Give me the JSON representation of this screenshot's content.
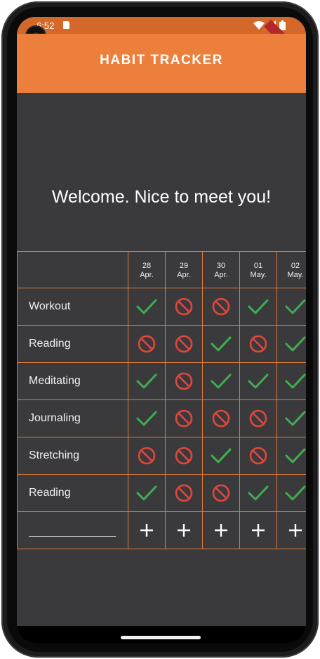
{
  "status_bar": {
    "time": "6:52"
  },
  "app_bar": {
    "title": "HABIT TRACKER",
    "debug_banner": "DEBUG"
  },
  "welcome": "Welcome. Nice to meet you!",
  "dates": [
    {
      "day": "28",
      "month": "Apr."
    },
    {
      "day": "29",
      "month": "Apr."
    },
    {
      "day": "30",
      "month": "Apr."
    },
    {
      "day": "01",
      "month": "May."
    },
    {
      "day": "02",
      "month": "May."
    }
  ],
  "habits": [
    {
      "name": "Workout",
      "marks": [
        "done",
        "missed",
        "missed",
        "done",
        "done"
      ]
    },
    {
      "name": "Reading",
      "marks": [
        "missed",
        "missed",
        "done",
        "missed",
        "done"
      ]
    },
    {
      "name": "Meditating",
      "marks": [
        "done",
        "missed",
        "done",
        "done",
        "done"
      ]
    },
    {
      "name": "Journaling",
      "marks": [
        "done",
        "missed",
        "missed",
        "missed",
        "done"
      ]
    },
    {
      "name": "Stretching",
      "marks": [
        "missed",
        "missed",
        "done",
        "missed",
        "done"
      ]
    },
    {
      "name": "Reading",
      "marks": [
        "done",
        "missed",
        "missed",
        "done",
        "done"
      ]
    }
  ],
  "add_row": {
    "symbol": "+"
  },
  "colors": {
    "accent": "#ec7f3c",
    "background": "#3a3a3c",
    "done": "#3fae53",
    "missed": "#e2463c"
  },
  "icons": {
    "done": "check-icon",
    "missed": "no-entry-icon"
  }
}
